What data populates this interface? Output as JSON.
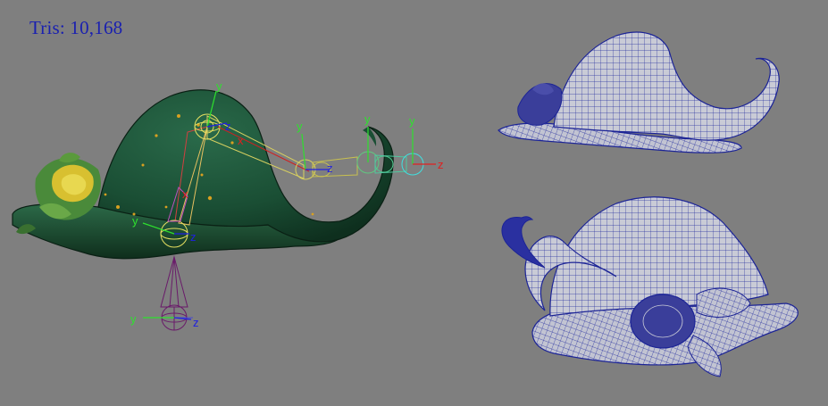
{
  "hud": {
    "tris_label": "Tris:",
    "tris_value": "10,168"
  },
  "axes": {
    "x": "x",
    "y": "y",
    "z": "z"
  },
  "colors": {
    "viewport_bg": "#7f7f7f",
    "hud_text": "#1a20b0",
    "hat_green_dark": "#123a22",
    "hat_green": "#1f5a36",
    "hat_teal": "#2d6e64",
    "wire_blue": "#1c2496",
    "mesh_fill": "#c9cbd6",
    "axis_y": "#2ee02e",
    "axis_x": "#e02020",
    "axis_z": "#2020e0",
    "joint_yellow": "#e6e060",
    "joint_cyan": "#40e0e0",
    "joint_purple": "#7a1a6a"
  },
  "icons": [
    "joint-chain-icon",
    "locator-icon"
  ]
}
